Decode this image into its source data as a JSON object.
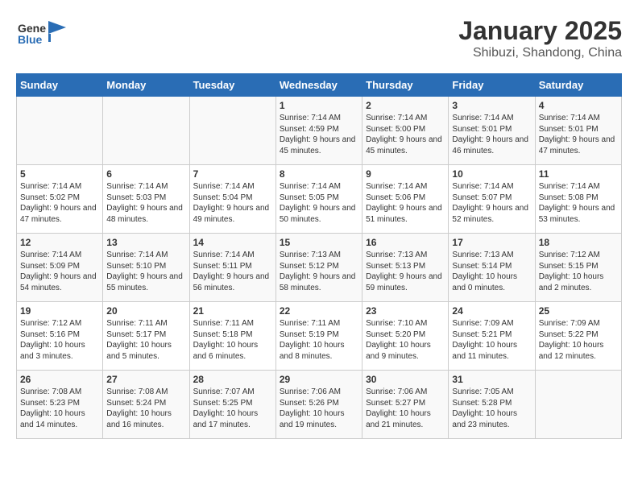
{
  "header": {
    "logo_general": "General",
    "logo_blue": "Blue",
    "title": "January 2025",
    "subtitle": "Shibuzi, Shandong, China"
  },
  "days_of_week": [
    "Sunday",
    "Monday",
    "Tuesday",
    "Wednesday",
    "Thursday",
    "Friday",
    "Saturday"
  ],
  "weeks": [
    [
      {
        "day": "",
        "info": ""
      },
      {
        "day": "",
        "info": ""
      },
      {
        "day": "",
        "info": ""
      },
      {
        "day": "1",
        "info": "Sunrise: 7:14 AM\nSunset: 4:59 PM\nDaylight: 9 hours and 45 minutes."
      },
      {
        "day": "2",
        "info": "Sunrise: 7:14 AM\nSunset: 5:00 PM\nDaylight: 9 hours and 45 minutes."
      },
      {
        "day": "3",
        "info": "Sunrise: 7:14 AM\nSunset: 5:01 PM\nDaylight: 9 hours and 46 minutes."
      },
      {
        "day": "4",
        "info": "Sunrise: 7:14 AM\nSunset: 5:01 PM\nDaylight: 9 hours and 47 minutes."
      }
    ],
    [
      {
        "day": "5",
        "info": "Sunrise: 7:14 AM\nSunset: 5:02 PM\nDaylight: 9 hours and 47 minutes."
      },
      {
        "day": "6",
        "info": "Sunrise: 7:14 AM\nSunset: 5:03 PM\nDaylight: 9 hours and 48 minutes."
      },
      {
        "day": "7",
        "info": "Sunrise: 7:14 AM\nSunset: 5:04 PM\nDaylight: 9 hours and 49 minutes."
      },
      {
        "day": "8",
        "info": "Sunrise: 7:14 AM\nSunset: 5:05 PM\nDaylight: 9 hours and 50 minutes."
      },
      {
        "day": "9",
        "info": "Sunrise: 7:14 AM\nSunset: 5:06 PM\nDaylight: 9 hours and 51 minutes."
      },
      {
        "day": "10",
        "info": "Sunrise: 7:14 AM\nSunset: 5:07 PM\nDaylight: 9 hours and 52 minutes."
      },
      {
        "day": "11",
        "info": "Sunrise: 7:14 AM\nSunset: 5:08 PM\nDaylight: 9 hours and 53 minutes."
      }
    ],
    [
      {
        "day": "12",
        "info": "Sunrise: 7:14 AM\nSunset: 5:09 PM\nDaylight: 9 hours and 54 minutes."
      },
      {
        "day": "13",
        "info": "Sunrise: 7:14 AM\nSunset: 5:10 PM\nDaylight: 9 hours and 55 minutes."
      },
      {
        "day": "14",
        "info": "Sunrise: 7:14 AM\nSunset: 5:11 PM\nDaylight: 9 hours and 56 minutes."
      },
      {
        "day": "15",
        "info": "Sunrise: 7:13 AM\nSunset: 5:12 PM\nDaylight: 9 hours and 58 minutes."
      },
      {
        "day": "16",
        "info": "Sunrise: 7:13 AM\nSunset: 5:13 PM\nDaylight: 9 hours and 59 minutes."
      },
      {
        "day": "17",
        "info": "Sunrise: 7:13 AM\nSunset: 5:14 PM\nDaylight: 10 hours and 0 minutes."
      },
      {
        "day": "18",
        "info": "Sunrise: 7:12 AM\nSunset: 5:15 PM\nDaylight: 10 hours and 2 minutes."
      }
    ],
    [
      {
        "day": "19",
        "info": "Sunrise: 7:12 AM\nSunset: 5:16 PM\nDaylight: 10 hours and 3 minutes."
      },
      {
        "day": "20",
        "info": "Sunrise: 7:11 AM\nSunset: 5:17 PM\nDaylight: 10 hours and 5 minutes."
      },
      {
        "day": "21",
        "info": "Sunrise: 7:11 AM\nSunset: 5:18 PM\nDaylight: 10 hours and 6 minutes."
      },
      {
        "day": "22",
        "info": "Sunrise: 7:11 AM\nSunset: 5:19 PM\nDaylight: 10 hours and 8 minutes."
      },
      {
        "day": "23",
        "info": "Sunrise: 7:10 AM\nSunset: 5:20 PM\nDaylight: 10 hours and 9 minutes."
      },
      {
        "day": "24",
        "info": "Sunrise: 7:09 AM\nSunset: 5:21 PM\nDaylight: 10 hours and 11 minutes."
      },
      {
        "day": "25",
        "info": "Sunrise: 7:09 AM\nSunset: 5:22 PM\nDaylight: 10 hours and 12 minutes."
      }
    ],
    [
      {
        "day": "26",
        "info": "Sunrise: 7:08 AM\nSunset: 5:23 PM\nDaylight: 10 hours and 14 minutes."
      },
      {
        "day": "27",
        "info": "Sunrise: 7:08 AM\nSunset: 5:24 PM\nDaylight: 10 hours and 16 minutes."
      },
      {
        "day": "28",
        "info": "Sunrise: 7:07 AM\nSunset: 5:25 PM\nDaylight: 10 hours and 17 minutes."
      },
      {
        "day": "29",
        "info": "Sunrise: 7:06 AM\nSunset: 5:26 PM\nDaylight: 10 hours and 19 minutes."
      },
      {
        "day": "30",
        "info": "Sunrise: 7:06 AM\nSunset: 5:27 PM\nDaylight: 10 hours and 21 minutes."
      },
      {
        "day": "31",
        "info": "Sunrise: 7:05 AM\nSunset: 5:28 PM\nDaylight: 10 hours and 23 minutes."
      },
      {
        "day": "",
        "info": ""
      }
    ]
  ]
}
